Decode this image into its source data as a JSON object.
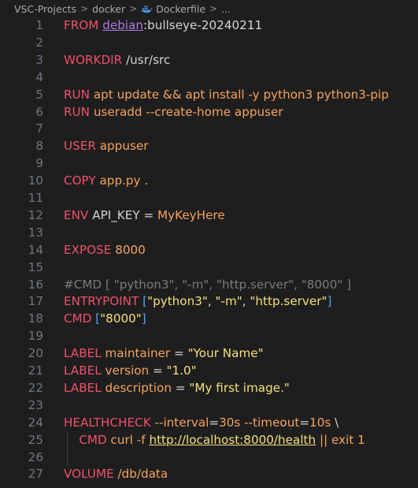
{
  "breadcrumb": {
    "items": [
      "VSC-Projects",
      "docker",
      "Dockerfile",
      "..."
    ],
    "separator": ">"
  },
  "colors": {
    "background": "#1e1e1e",
    "keyword": "#f0506e",
    "string": "#f4e07a",
    "value": "#f5a35c",
    "bracket": "#4ea0ff",
    "comment": "#7a7a7a",
    "line_number": "#6e7681"
  },
  "icons": {
    "file": "docker-icon"
  },
  "editor": {
    "lines": [
      {
        "n": "1",
        "t": [
          [
            "kw",
            "FROM "
          ],
          [
            "img",
            "debian"
          ],
          [
            "pl",
            ":bullseye-20240211"
          ]
        ]
      },
      {
        "n": "2",
        "t": []
      },
      {
        "n": "3",
        "t": [
          [
            "kw",
            "WORKDIR "
          ],
          [
            "pl",
            "/usr/src"
          ]
        ]
      },
      {
        "n": "4",
        "t": []
      },
      {
        "n": "5",
        "t": [
          [
            "kw",
            "RUN "
          ],
          [
            "val",
            "apt update && apt install -y python3 python3-pip"
          ]
        ]
      },
      {
        "n": "6",
        "t": [
          [
            "kw",
            "RUN "
          ],
          [
            "val",
            "useradd --create-home appuser"
          ]
        ]
      },
      {
        "n": "7",
        "t": []
      },
      {
        "n": "8",
        "t": [
          [
            "kw",
            "USER "
          ],
          [
            "val",
            "appuser"
          ]
        ]
      },
      {
        "n": "9",
        "t": []
      },
      {
        "n": "10",
        "t": [
          [
            "kw",
            "COPY "
          ],
          [
            "val",
            "app.py ."
          ]
        ]
      },
      {
        "n": "11",
        "t": []
      },
      {
        "n": "12",
        "t": [
          [
            "kw",
            "ENV "
          ],
          [
            "pl",
            "API_KEY = "
          ],
          [
            "val",
            "MyKeyHere"
          ]
        ]
      },
      {
        "n": "13",
        "t": []
      },
      {
        "n": "14",
        "t": [
          [
            "kw",
            "EXPOSE "
          ],
          [
            "val",
            "8000"
          ]
        ]
      },
      {
        "n": "15",
        "t": []
      },
      {
        "n": "16",
        "t": [
          [
            "dim",
            "#CMD [ \"python3\", \"-m\", \"http.server\", \"8000\" ]"
          ]
        ]
      },
      {
        "n": "17",
        "t": [
          [
            "kw",
            "ENTRYPOINT "
          ],
          [
            "br",
            "["
          ],
          [
            "str",
            "\"python3\""
          ],
          [
            "pl",
            ", "
          ],
          [
            "str",
            "\"-m\""
          ],
          [
            "pl",
            ", "
          ],
          [
            "str",
            "\"http.server\""
          ],
          [
            "br",
            "]"
          ]
        ]
      },
      {
        "n": "18",
        "t": [
          [
            "kw",
            "CMD "
          ],
          [
            "br",
            "["
          ],
          [
            "str",
            "\"8000\""
          ],
          [
            "br",
            "]"
          ]
        ]
      },
      {
        "n": "19",
        "t": []
      },
      {
        "n": "20",
        "t": [
          [
            "kw",
            "LABEL "
          ],
          [
            "val",
            "maintainer"
          ],
          [
            "pl",
            " = "
          ],
          [
            "str",
            "\"Your Name\""
          ]
        ]
      },
      {
        "n": "21",
        "t": [
          [
            "kw",
            "LABEL "
          ],
          [
            "val",
            "version"
          ],
          [
            "pl",
            " = "
          ],
          [
            "str",
            "\"1.0\""
          ]
        ]
      },
      {
        "n": "22",
        "t": [
          [
            "kw",
            "LABEL "
          ],
          [
            "val",
            "description"
          ],
          [
            "pl",
            " = "
          ],
          [
            "str",
            "\"My first image.\""
          ]
        ]
      },
      {
        "n": "23",
        "t": []
      },
      {
        "n": "24",
        "t": [
          [
            "kw",
            "HEALTHCHECK "
          ],
          [
            "val",
            "--interval"
          ],
          [
            "pl",
            "="
          ],
          [
            "val",
            "30s --timeout"
          ],
          [
            "pl",
            "="
          ],
          [
            "val",
            "10s "
          ],
          [
            "pl",
            "\\"
          ]
        ]
      },
      {
        "n": "25",
        "t": [
          [
            "pl",
            "    "
          ],
          [
            "kw",
            "CMD "
          ],
          [
            "val",
            "curl -f "
          ],
          [
            "lnk",
            "http://localhost:8000/health"
          ],
          [
            "val",
            " || exit 1"
          ]
        ]
      },
      {
        "n": "26",
        "t": []
      },
      {
        "n": "27",
        "t": [
          [
            "kw",
            "VOLUME "
          ],
          [
            "val",
            "/db/data"
          ]
        ]
      }
    ]
  }
}
